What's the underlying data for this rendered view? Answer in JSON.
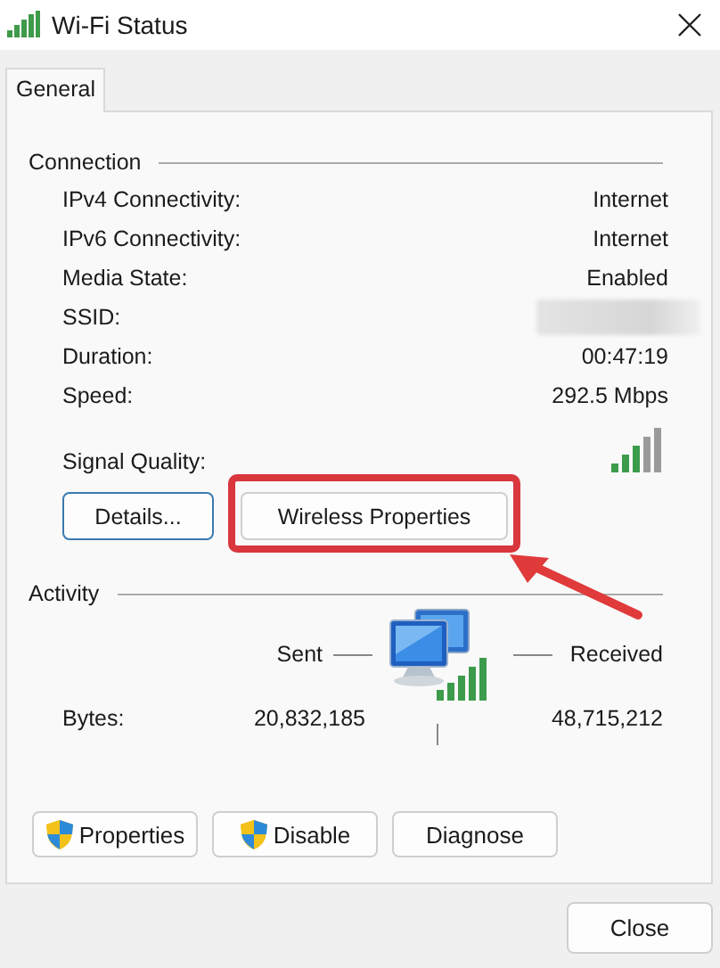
{
  "window": {
    "title": "Wi-Fi Status"
  },
  "tabs": [
    {
      "label": "General",
      "selected": true
    }
  ],
  "connection": {
    "heading": "Connection",
    "rows": [
      {
        "kind": "text",
        "label": "IPv4 Connectivity:",
        "value": "Internet"
      },
      {
        "kind": "text",
        "label": "IPv6 Connectivity:",
        "value": "Internet"
      },
      {
        "kind": "text",
        "label": "Media State:",
        "value": "Enabled"
      },
      {
        "kind": "blurred",
        "label": "SSID:"
      },
      {
        "kind": "text",
        "label": "Duration:",
        "value": "00:47:19"
      },
      {
        "kind": "text",
        "label": "Speed:",
        "value": "292.5 Mbps"
      },
      {
        "kind": "signal",
        "label": "Signal Quality:"
      }
    ]
  },
  "connection_buttons": [
    {
      "label": "Details...",
      "highlighted": false
    },
    {
      "label": "Wireless Properties",
      "highlighted": true
    }
  ],
  "activity": {
    "heading": "Activity",
    "sent": "Sent",
    "received": "Received",
    "rows": [
      {
        "label": "Bytes:",
        "sent": "20,832,185",
        "received": "48,715,212"
      }
    ]
  },
  "actions": [
    {
      "label": "Properties",
      "shield": true
    },
    {
      "label": "Disable",
      "shield": true
    },
    {
      "label": "Diagnose",
      "shield": false
    }
  ],
  "footer_buttons": [
    "Close"
  ]
}
